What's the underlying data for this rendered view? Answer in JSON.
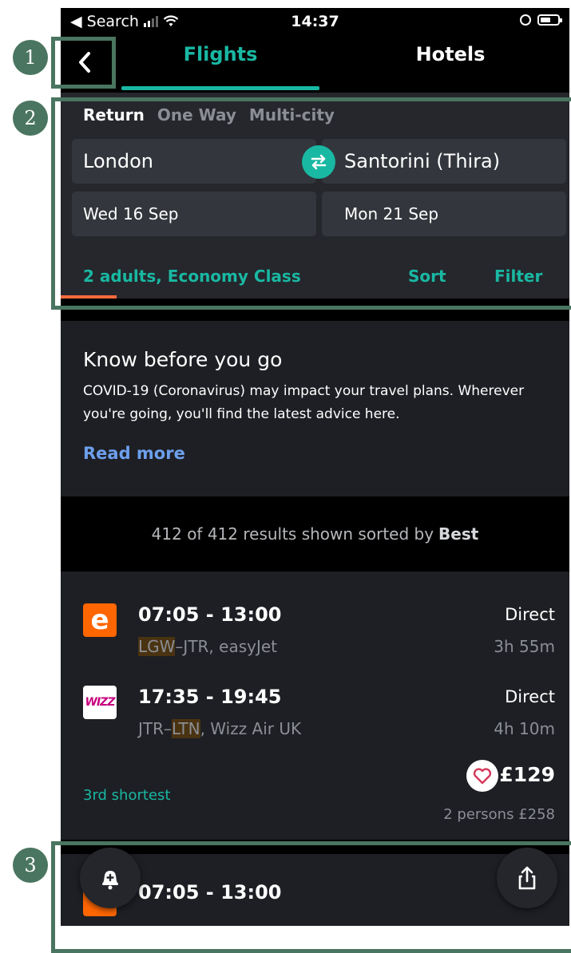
{
  "status_bar": {
    "back_app": "◀ Search",
    "time": "14:37"
  },
  "nav": {
    "tabs": [
      {
        "label": "Flights",
        "active": true
      },
      {
        "label": "Hotels",
        "active": false
      }
    ]
  },
  "search": {
    "trip_types": [
      "Return",
      "One Way",
      "Multi-city"
    ],
    "selected_trip_type": "Return",
    "origin": "London",
    "destination": "Santorini (Thira)",
    "depart_date": "Wed 16 Sep",
    "return_date": "Mon 21 Sep",
    "passengers": "2 adults, Economy Class",
    "sort_label": "Sort",
    "filter_label": "Filter"
  },
  "advisory": {
    "title": "Know before you go",
    "body": "COVID-19 (Coronavirus) may impact your travel plans. Wherever you're going, you'll find the latest advice here.",
    "link": "Read more"
  },
  "results": {
    "summary": "412 of 412 results shown sorted by",
    "sort_mode": "Best"
  },
  "flights": [
    {
      "outbound": {
        "logo": "e",
        "time": "07:05 - 13:00",
        "origin": "LGW",
        "rest": "–JTR, easyJet",
        "stops": "Direct",
        "duration": "3h 55m"
      },
      "inbound": {
        "logo": "WIZZ",
        "pre": "JTR–",
        "dest": "LTN",
        "airline": ", Wizz Air UK",
        "time": "17:35 - 19:45",
        "stops": "Direct",
        "duration": "4h 10m"
      },
      "tag": "3rd shortest",
      "price": "£129",
      "total": "2 persons £258"
    },
    {
      "outbound": {
        "time": "07:05 - 13:00"
      }
    }
  ],
  "annotations": [
    "1",
    "2",
    "3"
  ],
  "colors": {
    "accent": "#19b8a3",
    "link": "#6d9fec",
    "annotation": "#4a7560",
    "easyjet": "#ff6600"
  }
}
